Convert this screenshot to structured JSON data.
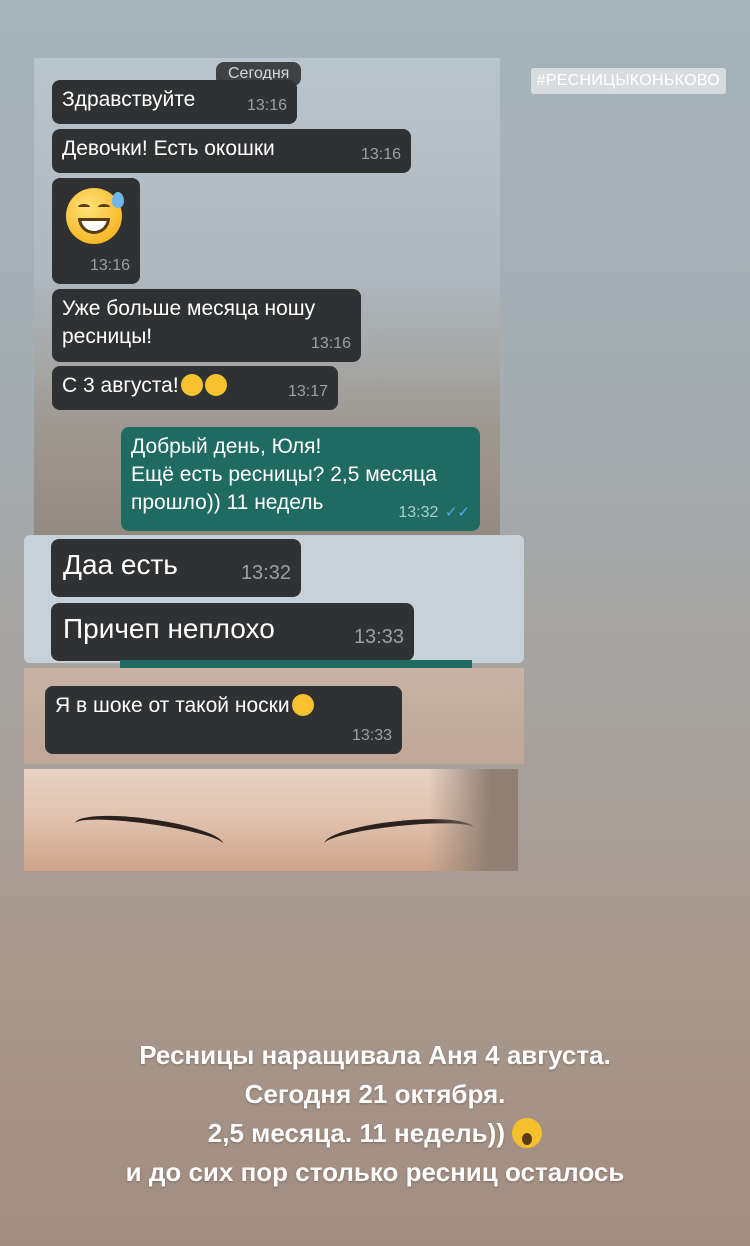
{
  "hashtag": "#РЕСНИЦЫКОНЬКОВО",
  "chat1": {
    "date": "Сегодня",
    "messages": [
      {
        "text": "Здравствуйте",
        "time": "13:16"
      },
      {
        "text": "Девочки! Есть окошки",
        "time": "13:16"
      },
      {
        "emoji": "grinning-sweat-emoji",
        "time": "13:16"
      },
      {
        "line1": "Уже больше месяца ношу",
        "line2": "ресницы!",
        "time": "13:16"
      },
      {
        "text": "С 3 августа!",
        "time": "13:17"
      }
    ],
    "outgoing": {
      "line1": "Добрый день, Юля!",
      "line2": "Ещё есть ресницы? 2,5 месяца",
      "line3": "прошло)) 11 недель",
      "time": "13:32",
      "ticks": "✓✓"
    }
  },
  "chat2": {
    "messages": [
      {
        "text": "Даа есть",
        "time": "13:32"
      },
      {
        "text": "Причеп неплохо",
        "time": "13:33"
      }
    ]
  },
  "chat3": {
    "messages": [
      {
        "text": "Я в шоке от такой носки",
        "time": "13:33"
      }
    ]
  },
  "caption": {
    "line1": "Ресницы наращивала Аня 4 августа.",
    "line2": "Сегодня 21 октября.",
    "line3": "2,5 месяца. 11 недель))",
    "line4": "и до сих пор столько ресниц осталось"
  },
  "colors": {
    "incoming": "#2f3133",
    "outgoing": "#1f6b62",
    "read_ticks": "#56a8e8"
  }
}
